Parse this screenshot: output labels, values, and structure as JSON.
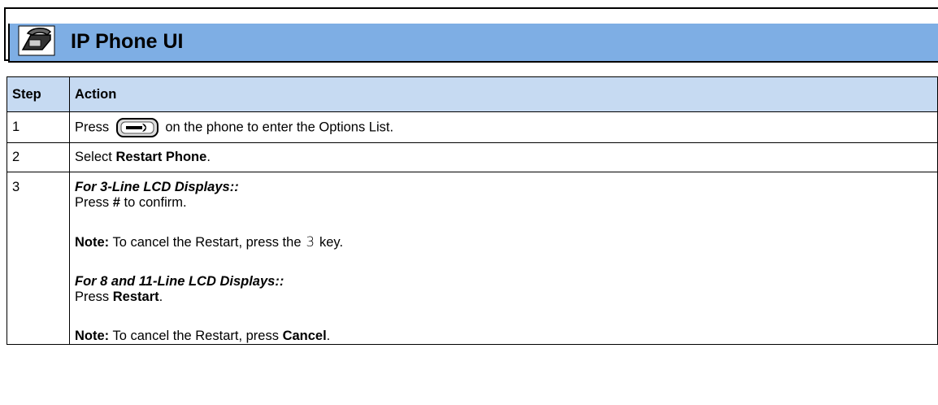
{
  "header": {
    "title": "IP Phone UI",
    "icon": "phone-handset-icon"
  },
  "table": {
    "columns": [
      "Step",
      "Action"
    ],
    "rows": [
      {
        "step": "1",
        "pre": "Press",
        "icon": "options-key-icon",
        "post": "on the phone to enter the Options List."
      },
      {
        "step": "2",
        "pre": "Select ",
        "bold": "Restart Phone",
        "post": "."
      },
      {
        "step": "3",
        "sub1": "For 3-Line LCD Displays::",
        "l1_pre": "Press ",
        "l1_bold": "#",
        "l1_post": " to confirm.",
        "note1_label": "Note:",
        "note1_pre": " To cancel the Restart, press the",
        "note1_key": "3",
        "note1_post": "key.",
        "sub2": "For 8 and 11-Line LCD Displays::",
        "l2_pre": "Press ",
        "l2_bold": "Restart",
        "l2_post": ".",
        "note2_label": "Note:",
        "note2_pre": " To cancel the Restart, press ",
        "note2_bold": "Cancel",
        "note2_post": "."
      }
    ]
  }
}
